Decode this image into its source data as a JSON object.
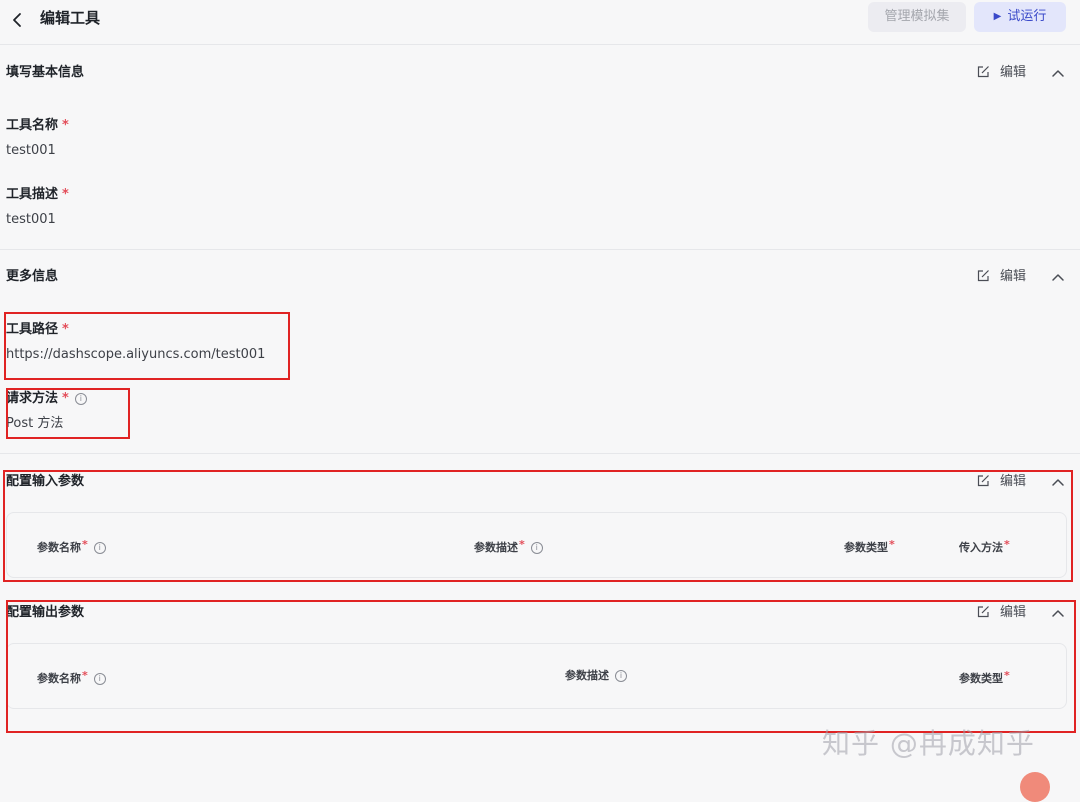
{
  "header": {
    "title": "编辑工具",
    "manage_button": "管理模拟集",
    "run_button": "试运行"
  },
  "basic_info": {
    "title": "填写基本信息",
    "edit_label": "编辑",
    "name_label": "工具名称",
    "name_value": "test001",
    "desc_label": "工具描述",
    "desc_value": "test001"
  },
  "more_info": {
    "title": "更多信息",
    "edit_label": "编辑",
    "path_label": "工具路径",
    "path_value": "https://dashscope.aliyuncs.com/test001",
    "method_label": "请求方法",
    "method_value": "Post 方法"
  },
  "input_params": {
    "title": "配置输入参数",
    "edit_label": "编辑",
    "columns": [
      "参数名称",
      "参数描述",
      "参数类型",
      "传入方法"
    ]
  },
  "output_params": {
    "title": "配置输出参数",
    "edit_label": "编辑",
    "columns": [
      "参数名称",
      "参数描述",
      "参数类型"
    ]
  },
  "required_mark": "*",
  "watermark": "知乎 @冉成知乎",
  "colors": {
    "accent": "#3a49c9",
    "required": "#e34d59",
    "highlight_box": "#e02323"
  },
  "icons": {
    "back": "chevron-left-icon",
    "run": "play-icon",
    "edit": "edit-icon",
    "collapse": "chevron-up-icon",
    "info": "info-icon"
  }
}
